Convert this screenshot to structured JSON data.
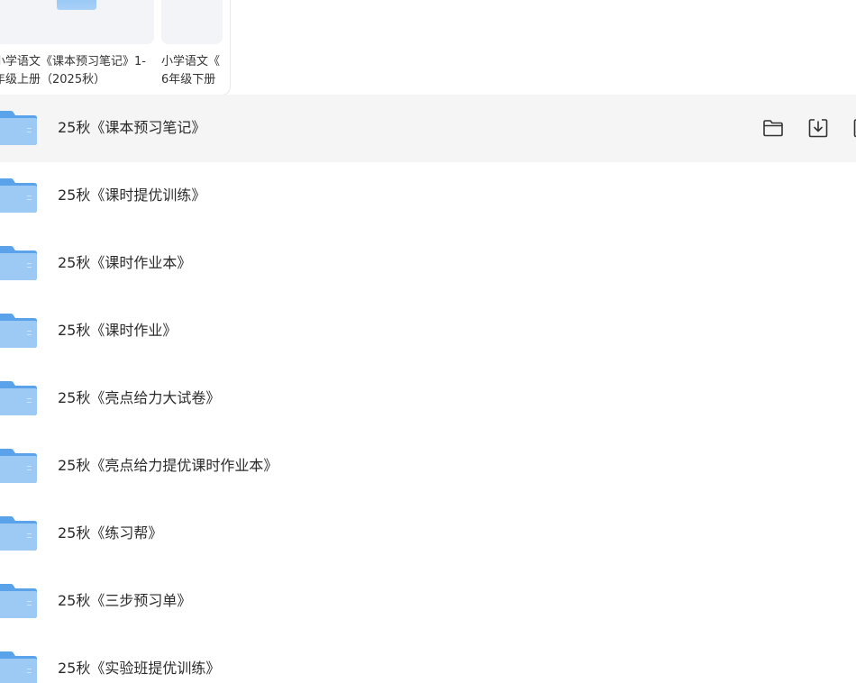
{
  "cards": [
    {
      "title_line1": "小学语文《课本预习笔记》1-",
      "title_line2": "年级上册（2025秋）"
    },
    {
      "title_line1": "小学语文《",
      "title_line2": "6年级下册"
    }
  ],
  "folders": [
    {
      "name": "25秋《课本预习笔记》"
    },
    {
      "name": "25秋《课时提优训练》"
    },
    {
      "name": "25秋《课时作业本》"
    },
    {
      "name": "25秋《课时作业》"
    },
    {
      "name": "25秋《亮点给力大试卷》"
    },
    {
      "name": "25秋《亮点给力提优课时作业本》"
    },
    {
      "name": "25秋《练习帮》"
    },
    {
      "name": "25秋《三步预习单》"
    },
    {
      "name": "25秋《实验班提优训练》"
    }
  ],
  "row_actions": {
    "icons": [
      "folder-open-icon",
      "download-icon",
      "more-icon"
    ]
  },
  "colors": {
    "folder_blue": "#6aaef0",
    "hover_row": "#f5f5f6"
  }
}
